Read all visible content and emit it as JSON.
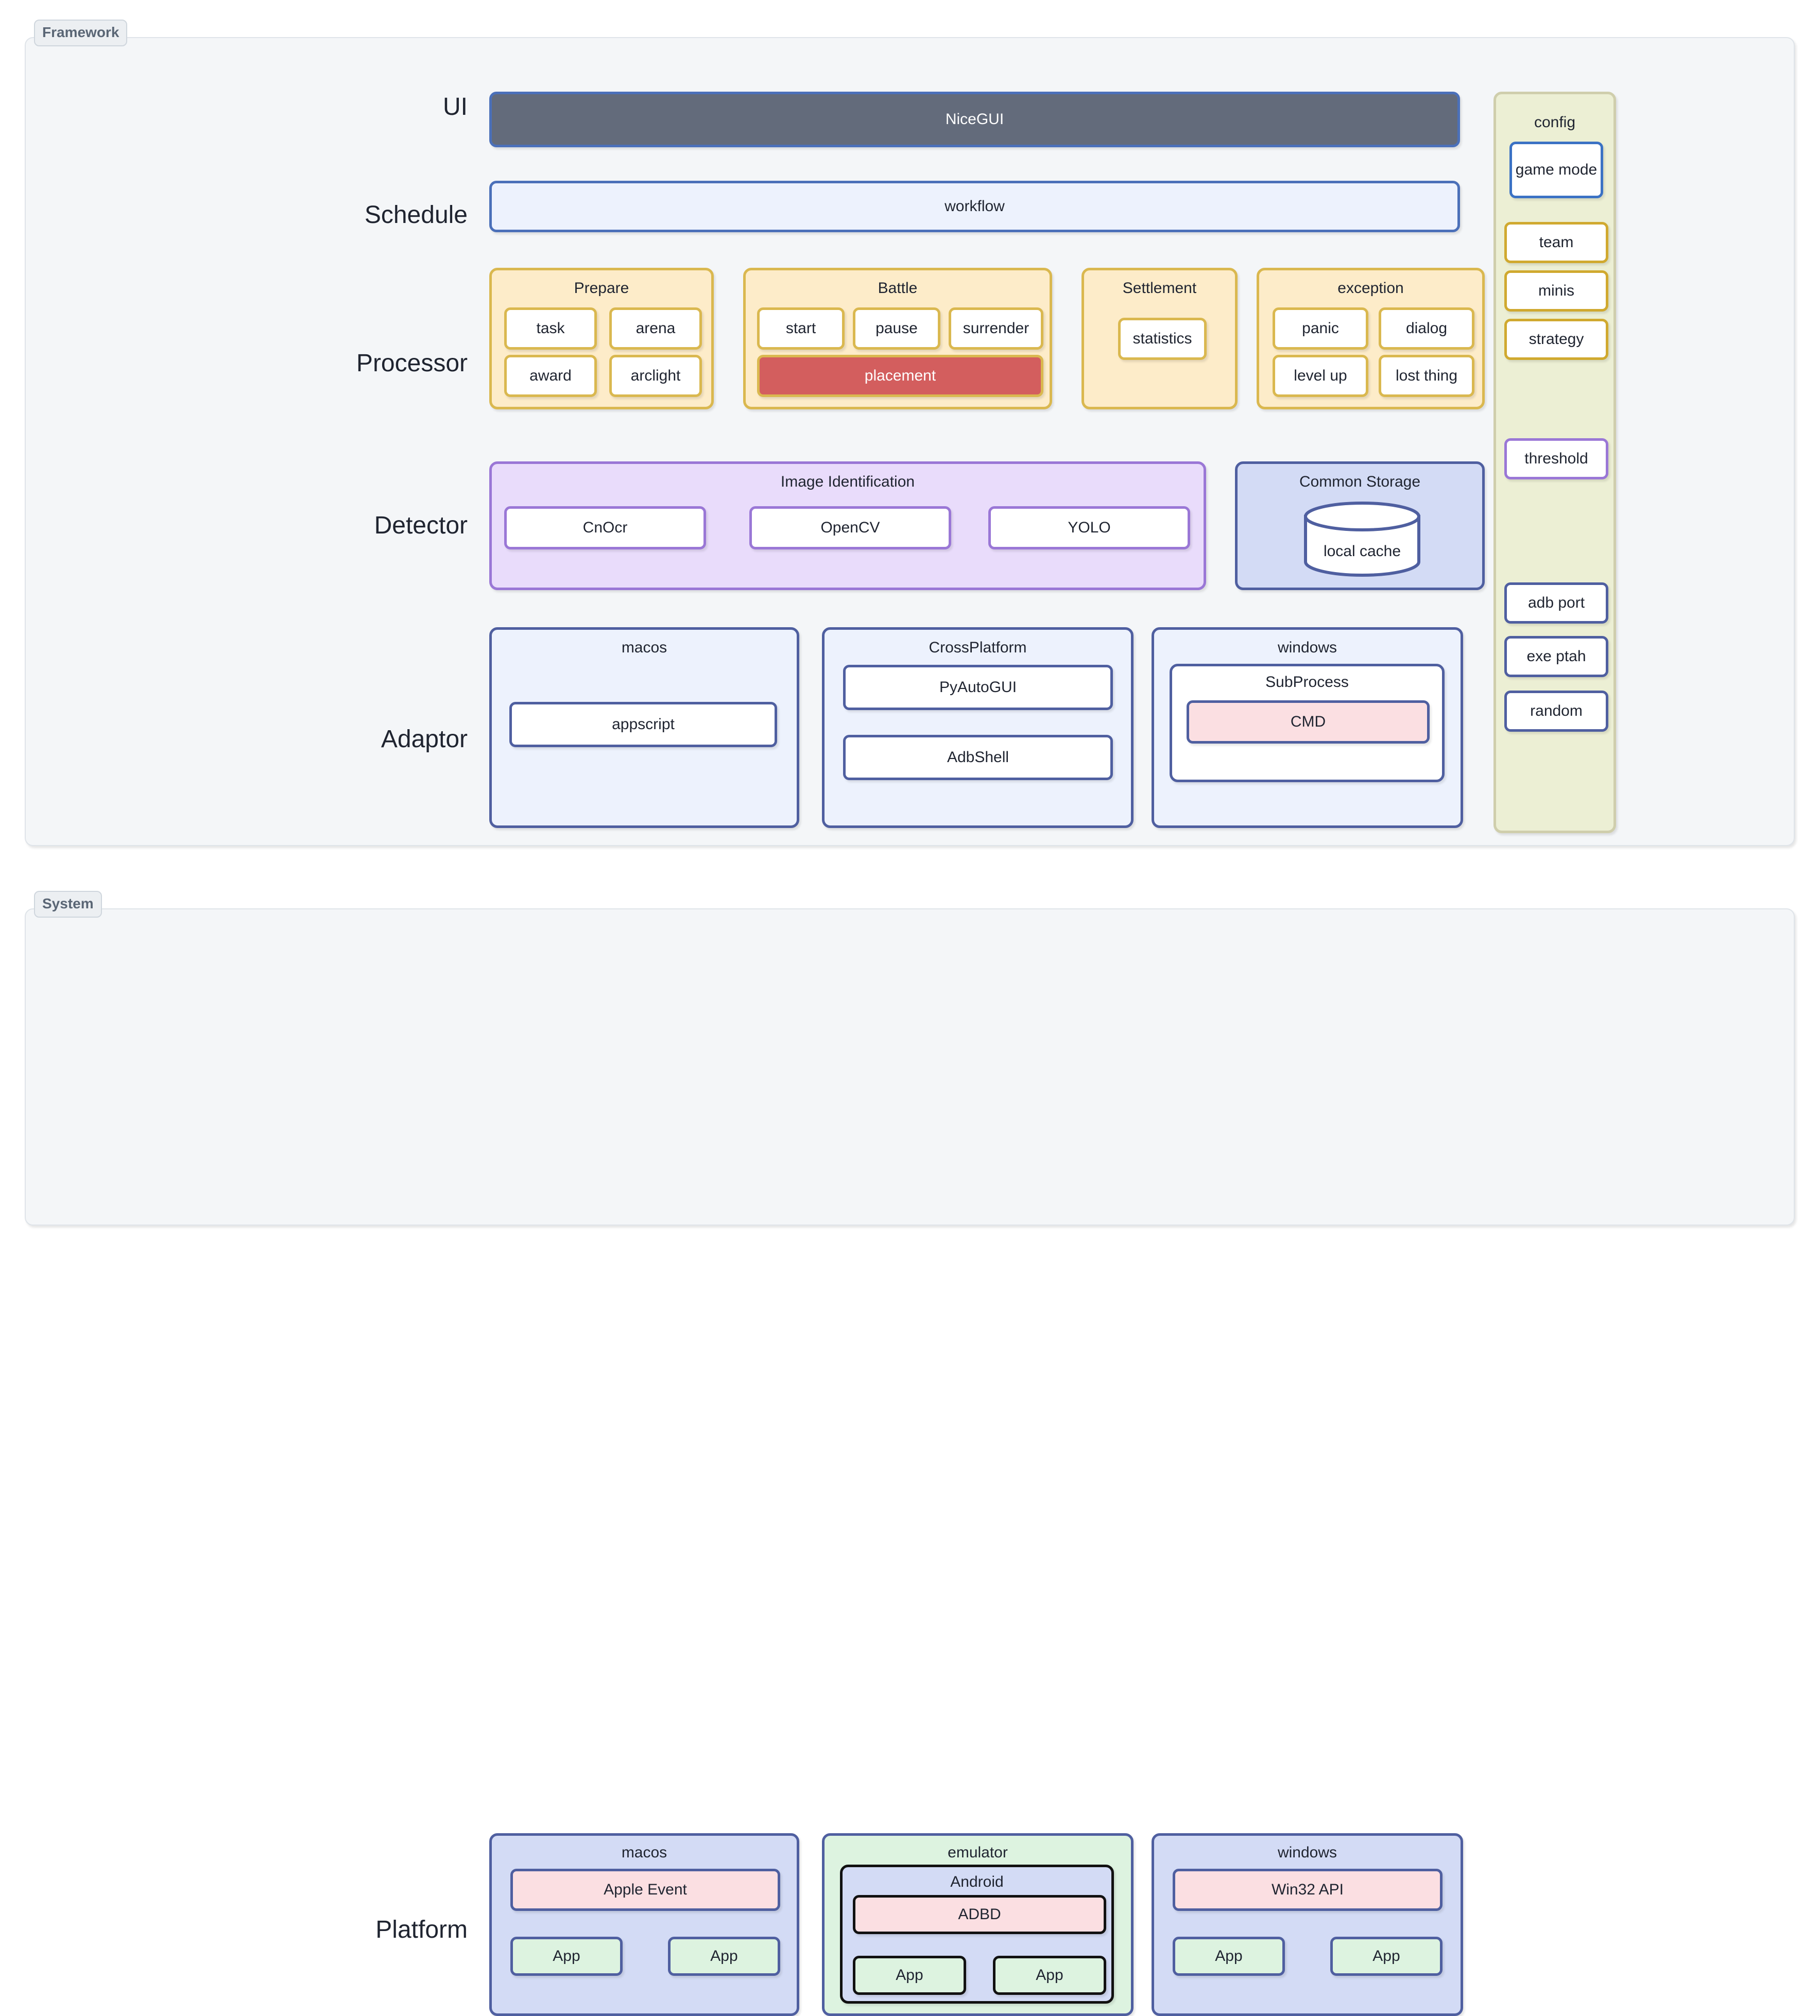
{
  "sections": {
    "framework": {
      "tag": "Framework"
    },
    "system": {
      "tag": "System"
    }
  },
  "row_labels": {
    "ui": "UI",
    "schedule": "Schedule",
    "processor": "Processor",
    "detector": "Detector",
    "adaptor": "Adaptor",
    "platform": "Platform"
  },
  "ui": {
    "nicegui": "NiceGUI"
  },
  "schedule": {
    "workflow": "workflow"
  },
  "processor": {
    "prepare": {
      "title": "Prepare",
      "items": [
        "task",
        "arena",
        "award",
        "arclight"
      ]
    },
    "battle": {
      "title": "Battle",
      "items": [
        "start",
        "pause",
        "surrender"
      ],
      "highlight": "placement"
    },
    "settlement": {
      "title": "Settlement",
      "items": [
        "statistics"
      ]
    },
    "exception": {
      "title": "exception",
      "items": [
        "panic",
        "dialog",
        "level up",
        "lost thing"
      ]
    }
  },
  "detector": {
    "image_identification": {
      "title": "Image Identification",
      "items": [
        "CnOcr",
        "OpenCV",
        "YOLO"
      ]
    },
    "common_storage": {
      "title": "Common Storage",
      "database": "local cache"
    }
  },
  "adaptor": {
    "macos": {
      "title": "macos",
      "items": [
        "appscript"
      ]
    },
    "crossplatform": {
      "title": "CrossPlatform",
      "items": [
        "PyAutoGUI",
        "AdbShell"
      ]
    },
    "windows": {
      "title": "windows",
      "subprocess": "SubProcess",
      "cmd": "CMD"
    }
  },
  "config": {
    "title": "config",
    "items": [
      {
        "label": "game mode",
        "accent": "#3b72c4"
      },
      {
        "label": "team",
        "accent": "#d0a92f"
      },
      {
        "label": "minis",
        "accent": "#d0a92f"
      },
      {
        "label": "strategy",
        "accent": "#d0a92f"
      },
      {
        "label": "threshold",
        "accent": "#9a77d6"
      },
      {
        "label": "adb port",
        "accent": "#4f5fa0"
      },
      {
        "label": "exe ptah",
        "accent": "#4f5fa0"
      },
      {
        "label": "random",
        "accent": "#4f5fa0"
      }
    ]
  },
  "platform": {
    "macos": {
      "title": "macos",
      "api": "Apple Event",
      "apps": [
        "App",
        "App"
      ]
    },
    "emulator": {
      "title": "emulator",
      "android": {
        "title": "Android",
        "daemon": "ADBD",
        "apps": [
          "App",
          "App"
        ]
      }
    },
    "windows": {
      "title": "windows",
      "api": "Win32 API",
      "apps": [
        "App",
        "App"
      ]
    }
  },
  "colors": {
    "page_bg": "#ffffff",
    "section_bg": "#f4f6f8",
    "section_border": "#dfe4e9",
    "tag_bg": "#eceff2",
    "tag_text": "#5a6675",
    "blue_border": "#4b70b9",
    "blue_pale": "#edf2fd",
    "blue_mid": "#d3dbf5",
    "slate_fill": "#636b7b",
    "gold_border": "#dab84f",
    "gold_pale": "#fdecc9",
    "red_fill": "#d35e5e",
    "purple_border": "#9a77d6",
    "purple_pale": "#e9dcfb",
    "navy_border": "#4f5fa0",
    "pink_fill": "#fbdfe2",
    "green_fill": "#ddf3e0",
    "olive_border": "#cfceac",
    "olive_fill": "#ecefd4",
    "black_border": "#111111"
  }
}
